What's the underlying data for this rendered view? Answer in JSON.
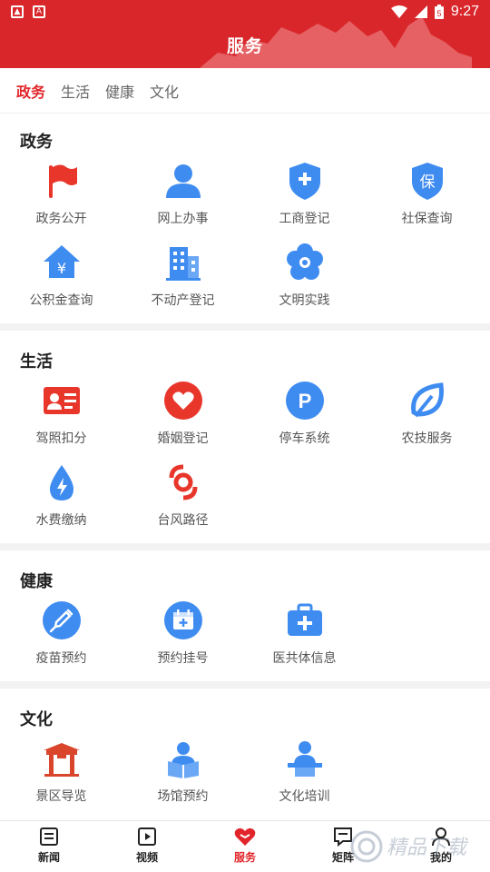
{
  "status_bar": {
    "time": "9:27",
    "battery": "5"
  },
  "header": {
    "title": "服务"
  },
  "tabs": [
    {
      "label": "政务",
      "active": true
    },
    {
      "label": "生活",
      "active": false
    },
    {
      "label": "健康",
      "active": false
    },
    {
      "label": "文化",
      "active": false
    }
  ],
  "sections": [
    {
      "title": "政务",
      "items": [
        {
          "label": "政务公开",
          "icon": "flag-icon"
        },
        {
          "label": "网上办事",
          "icon": "person-icon"
        },
        {
          "label": "工商登记",
          "icon": "shield-plus-icon"
        },
        {
          "label": "社保查询",
          "icon": "shield-bao-icon"
        },
        {
          "label": "公积金查询",
          "icon": "house-yen-icon"
        },
        {
          "label": "不动产登记",
          "icon": "building-icon"
        },
        {
          "label": "文明实践",
          "icon": "flower-icon"
        }
      ]
    },
    {
      "title": "生活",
      "items": [
        {
          "label": "驾照扣分",
          "icon": "id-card-icon"
        },
        {
          "label": "婚姻登记",
          "icon": "heart-icon"
        },
        {
          "label": "停车系统",
          "icon": "parking-icon"
        },
        {
          "label": "农技服务",
          "icon": "leaf-icon"
        },
        {
          "label": "水费缴纳",
          "icon": "water-drop-icon"
        },
        {
          "label": "台风路径",
          "icon": "typhoon-icon"
        }
      ]
    },
    {
      "title": "健康",
      "items": [
        {
          "label": "疫苗预约",
          "icon": "syringe-icon"
        },
        {
          "label": "预约挂号",
          "icon": "calendar-plus-icon"
        },
        {
          "label": "医共体信息",
          "icon": "medical-kit-icon"
        }
      ]
    },
    {
      "title": "文化",
      "items": [
        {
          "label": "景区导览",
          "icon": "gate-icon"
        },
        {
          "label": "场馆预约",
          "icon": "reader-icon"
        },
        {
          "label": "文化培训",
          "icon": "lecturer-icon"
        }
      ]
    }
  ],
  "bottom_nav": [
    {
      "label": "新闻",
      "icon": "news-icon",
      "active": false
    },
    {
      "label": "视频",
      "icon": "video-icon",
      "active": false
    },
    {
      "label": "服务",
      "icon": "service-heart-icon",
      "active": true
    },
    {
      "label": "矩阵",
      "icon": "matrix-icon",
      "active": false
    },
    {
      "label": "我的",
      "icon": "profile-icon",
      "active": false
    }
  ],
  "colors": {
    "brand_red": "#d9262a",
    "active_tab": "#e2252a",
    "icon_blue": "#3f8cf1",
    "icon_red": "#e8362b"
  }
}
